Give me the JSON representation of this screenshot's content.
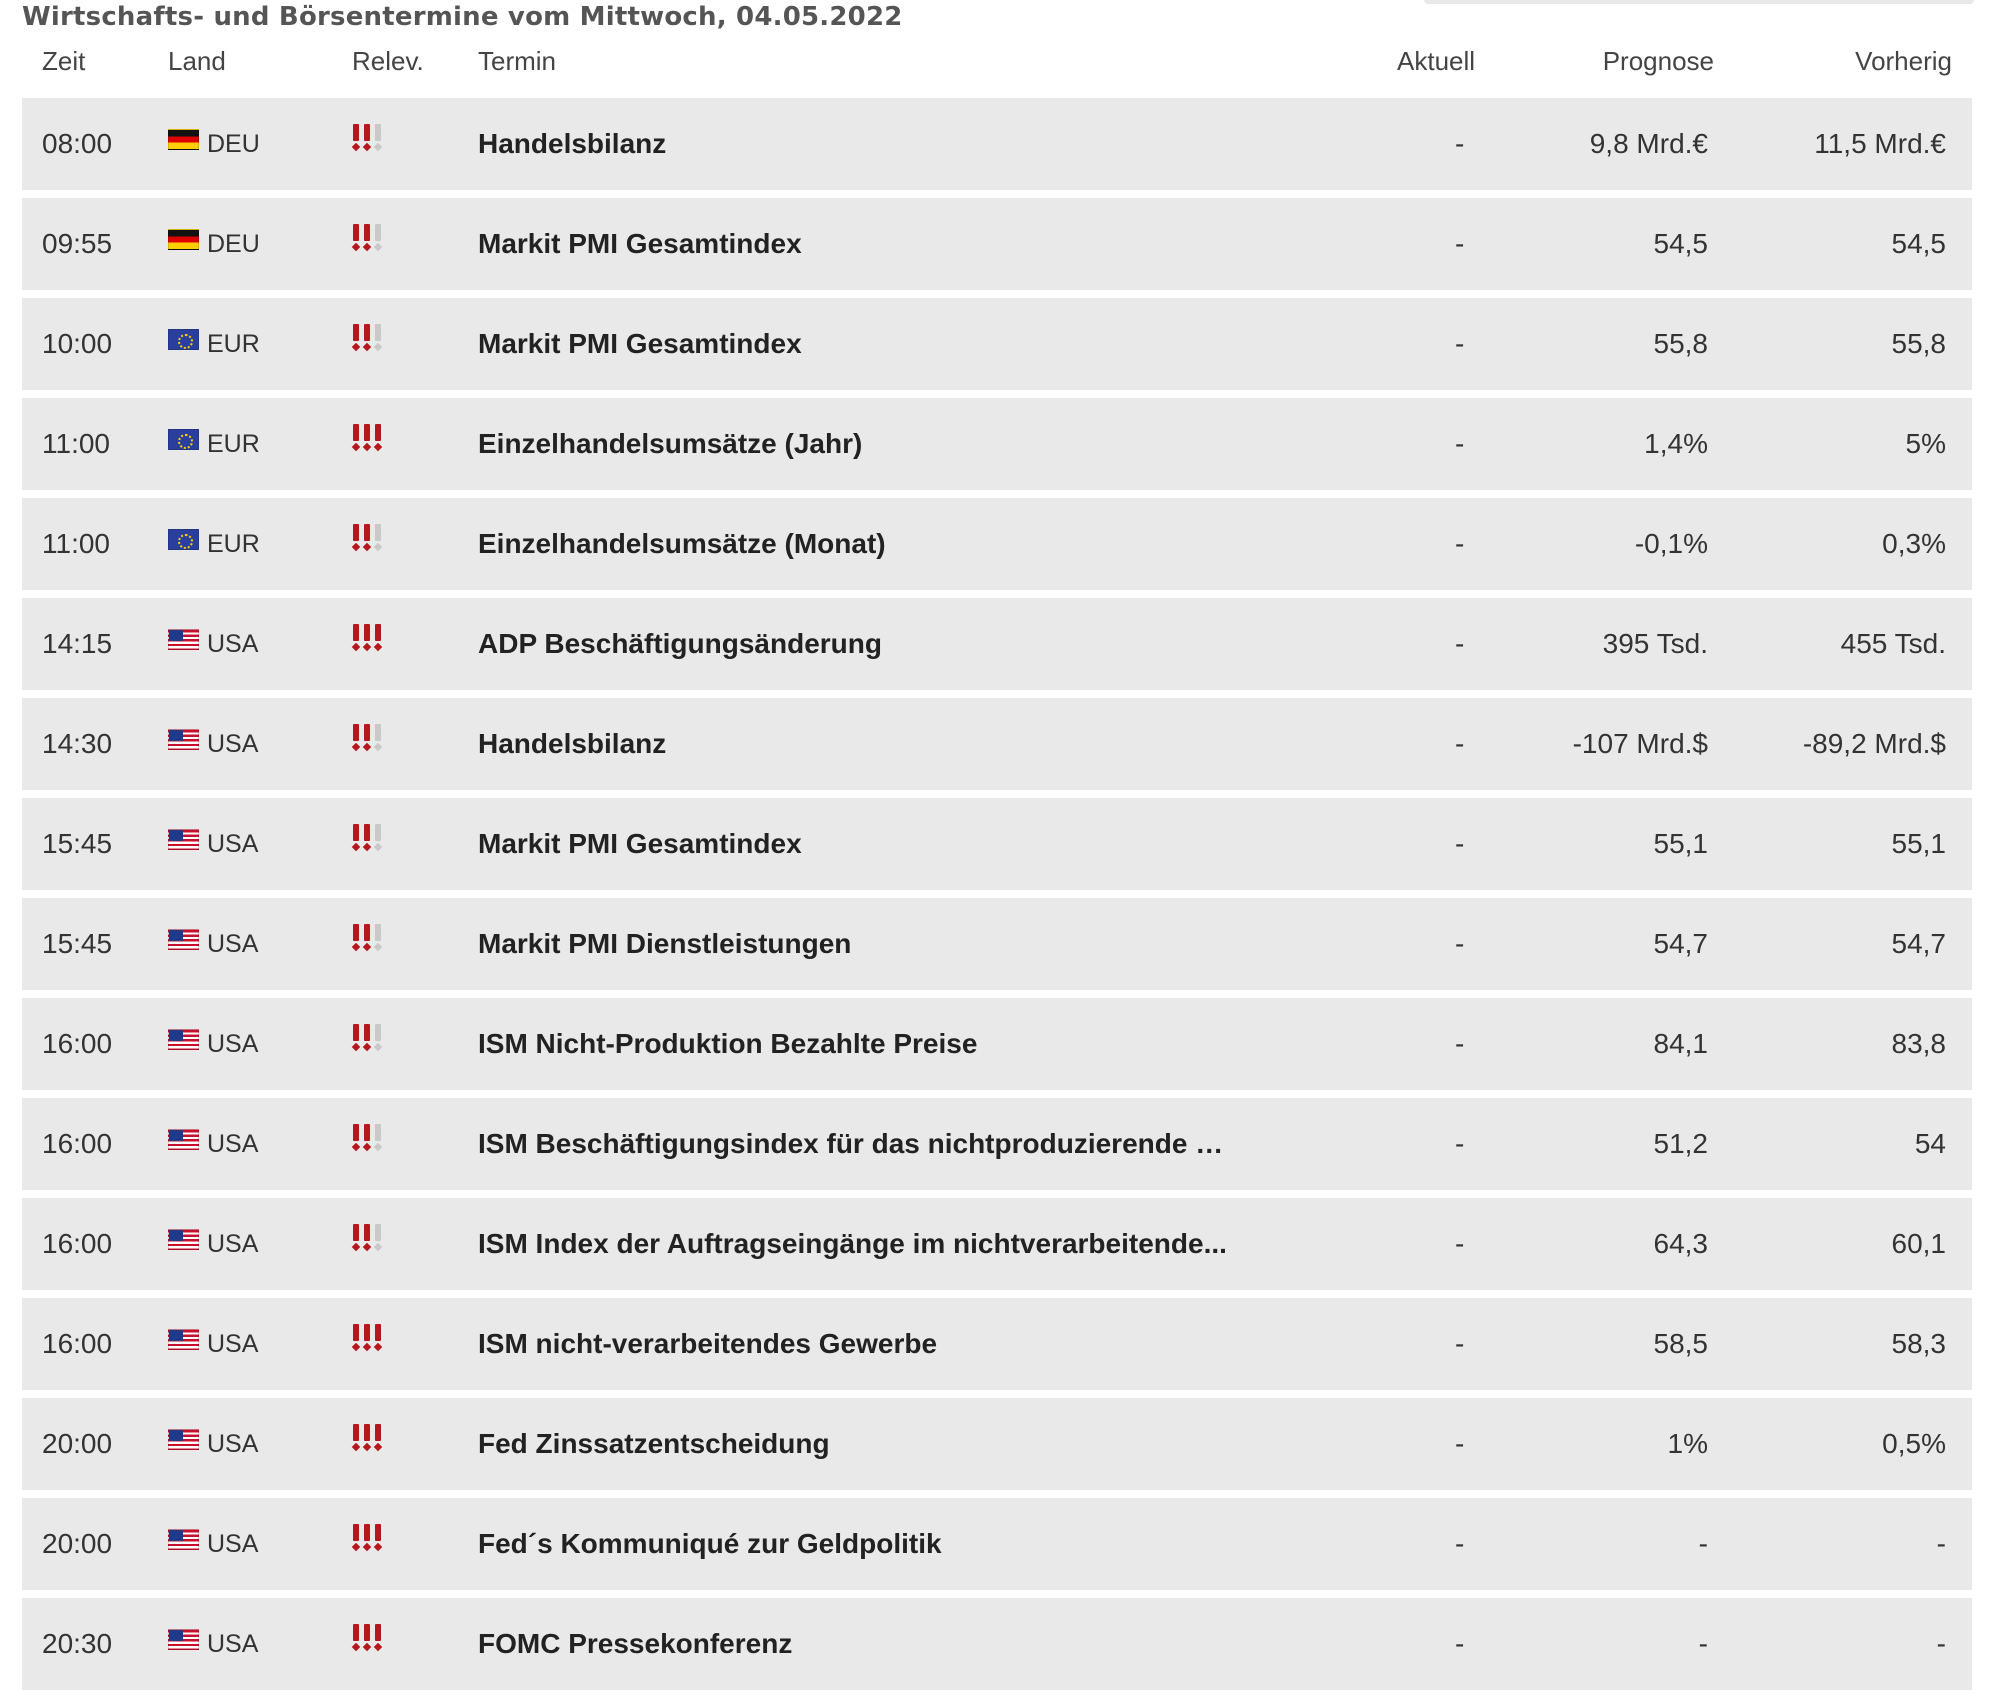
{
  "page": {
    "title": "Wirtschafts- und Börsentermine vom Mittwoch, 04.05.2022"
  },
  "header": {
    "zeit": "Zeit",
    "land": "Land",
    "relevanz": "Relev.",
    "termin": "Termin",
    "aktuell": "Aktuell",
    "prognose": "Prognose",
    "vorherig": "Vorherig"
  },
  "colors": {
    "row_bg": "#e9e9e9",
    "relevance_on": "#b5171c",
    "relevance_off": "#c9c9c9"
  },
  "rows": [
    {
      "zeit": "08:00",
      "flag": "deu-flag-icon",
      "land": "DEU",
      "relevanz": 2,
      "termin": "Handelsbilanz",
      "aktuell": "-",
      "prognose": "9,8 Mrd.€",
      "vorherig": "11,5 Mrd.€"
    },
    {
      "zeit": "09:55",
      "flag": "deu-flag-icon",
      "land": "DEU",
      "relevanz": 2,
      "termin": "Markit PMI Gesamtindex",
      "aktuell": "-",
      "prognose": "54,5",
      "vorherig": "54,5"
    },
    {
      "zeit": "10:00",
      "flag": "eur-flag-icon",
      "land": "EUR",
      "relevanz": 2,
      "termin": "Markit PMI Gesamtindex",
      "aktuell": "-",
      "prognose": "55,8",
      "vorherig": "55,8"
    },
    {
      "zeit": "11:00",
      "flag": "eur-flag-icon",
      "land": "EUR",
      "relevanz": 3,
      "termin": "Einzelhandelsumsätze (Jahr)",
      "aktuell": "-",
      "prognose": "1,4%",
      "vorherig": "5%"
    },
    {
      "zeit": "11:00",
      "flag": "eur-flag-icon",
      "land": "EUR",
      "relevanz": 2,
      "termin": "Einzelhandelsumsätze (Monat)",
      "aktuell": "-",
      "prognose": "-0,1%",
      "vorherig": "0,3%"
    },
    {
      "zeit": "14:15",
      "flag": "usa-flag-icon",
      "land": "USA",
      "relevanz": 3,
      "termin": "ADP Beschäftigungsänderung",
      "aktuell": "-",
      "prognose": "395 Tsd.",
      "vorherig": "455 Tsd."
    },
    {
      "zeit": "14:30",
      "flag": "usa-flag-icon",
      "land": "USA",
      "relevanz": 2,
      "termin": "Handelsbilanz",
      "aktuell": "-",
      "prognose": "-107 Mrd.$",
      "vorherig": "-89,2 Mrd.$"
    },
    {
      "zeit": "15:45",
      "flag": "usa-flag-icon",
      "land": "USA",
      "relevanz": 2,
      "termin": "Markit PMI Gesamtindex",
      "aktuell": "-",
      "prognose": "55,1",
      "vorherig": "55,1"
    },
    {
      "zeit": "15:45",
      "flag": "usa-flag-icon",
      "land": "USA",
      "relevanz": 2,
      "termin": "Markit PMI Dienstleistungen",
      "aktuell": "-",
      "prognose": "54,7",
      "vorherig": "54,7"
    },
    {
      "zeit": "16:00",
      "flag": "usa-flag-icon",
      "land": "USA",
      "relevanz": 2,
      "termin": "ISM Nicht-Produktion Bezahlte Preise",
      "aktuell": "-",
      "prognose": "84,1",
      "vorherig": "83,8"
    },
    {
      "zeit": "16:00",
      "flag": "usa-flag-icon",
      "land": "USA",
      "relevanz": 2,
      "termin": "ISM Beschäftigungsindex für das nichtproduzierende G...",
      "aktuell": "-",
      "prognose": "51,2",
      "vorherig": "54"
    },
    {
      "zeit": "16:00",
      "flag": "usa-flag-icon",
      "land": "USA",
      "relevanz": 2,
      "termin": "ISM Index der Auftragseingänge im nichtverarbeitende...",
      "aktuell": "-",
      "prognose": "64,3",
      "vorherig": "60,1"
    },
    {
      "zeit": "16:00",
      "flag": "usa-flag-icon",
      "land": "USA",
      "relevanz": 3,
      "termin": "ISM nicht-verarbeitendes Gewerbe",
      "aktuell": "-",
      "prognose": "58,5",
      "vorherig": "58,3"
    },
    {
      "zeit": "20:00",
      "flag": "usa-flag-icon",
      "land": "USA",
      "relevanz": 3,
      "termin": "Fed Zinssatzentscheidung",
      "aktuell": "-",
      "prognose": "1%",
      "vorherig": "0,5%"
    },
    {
      "zeit": "20:00",
      "flag": "usa-flag-icon",
      "land": "USA",
      "relevanz": 3,
      "termin": "Fed´s Kommuniqué zur Geldpolitik",
      "aktuell": "-",
      "prognose": "-",
      "vorherig": "-"
    },
    {
      "zeit": "20:30",
      "flag": "usa-flag-icon",
      "land": "USA",
      "relevanz": 3,
      "termin": "FOMC Pressekonferenz",
      "aktuell": "-",
      "prognose": "-",
      "vorherig": "-"
    }
  ]
}
